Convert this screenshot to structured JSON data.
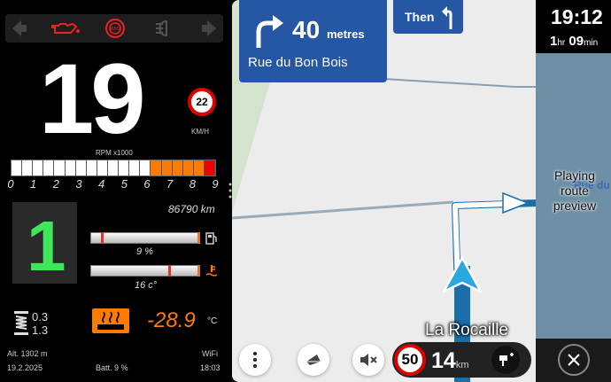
{
  "dashboard": {
    "speed": "19",
    "speed_limit": "22",
    "speed_unit": "KM/H",
    "rpm_label": "RPM x1000",
    "rpm_ticks": [
      "0",
      "1",
      "2",
      "3",
      "4",
      "5",
      "6",
      "7",
      "8",
      "9"
    ],
    "rpm_level": 0.615,
    "gear": "1",
    "odometer": "86790 km",
    "fuel_value": "9 %",
    "fuel_level": 0.09,
    "coolant_value": "16 c°",
    "coolant_level": 0.7,
    "suspension_front": "0.3",
    "suspension_rear": "1.3",
    "temperature": "-28.9",
    "temperature_unit": "°C",
    "altitude": "Alt. 1302 m",
    "date": "19.2.2025",
    "battery": "Batt. 9 %",
    "wifi": "WiFi",
    "time": "18:03",
    "colors": {
      "gear": "#3ee65a",
      "accent": "#ff7a00",
      "warning": "#e00000"
    },
    "warning_icons": [
      "left-arrow-icon",
      "oil-pressure-icon",
      "abs-icon",
      "headlight-icon",
      "right-arrow-icon"
    ]
  },
  "navigation": {
    "instruction": {
      "distance": "40",
      "unit": "metres",
      "street": "Rue du Bon Bois",
      "turn": "right"
    },
    "then": {
      "label": "Then",
      "turn": "left"
    },
    "clock": "19:12",
    "duration_hr": "1",
    "duration_hr_unit": "hr",
    "duration_min": "09",
    "duration_min_unit": "min",
    "status": "Playing route preview",
    "side_road": "Rue du",
    "current_street": "La Rocaille",
    "speed_limit": "50",
    "remaining_value": "14",
    "remaining_unit": "km",
    "colors": {
      "banner": "#2557a5",
      "route": "#1a6fa8",
      "map": "#ececec"
    }
  }
}
